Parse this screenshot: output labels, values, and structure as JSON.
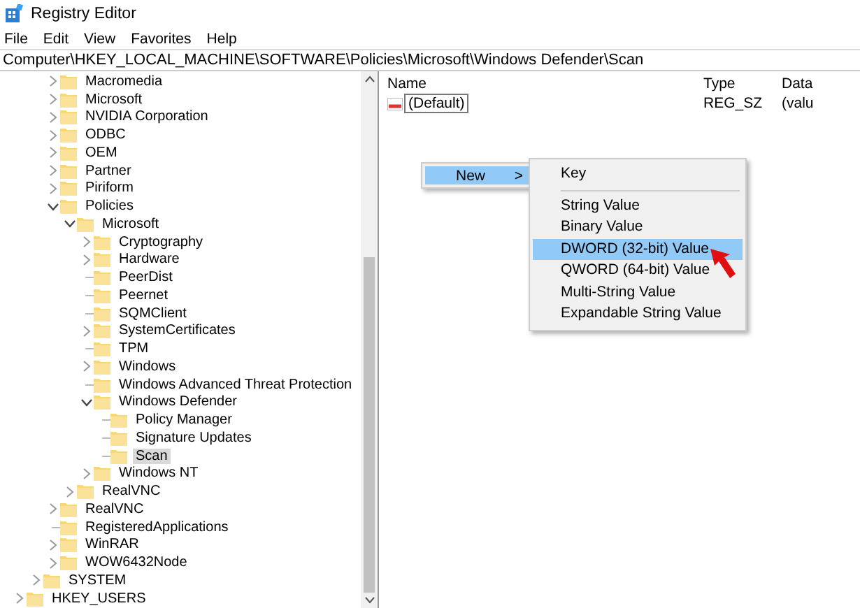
{
  "window": {
    "title": "Registry Editor"
  },
  "menu_bar": [
    "File",
    "Edit",
    "View",
    "Favorites",
    "Help"
  ],
  "address_bar": {
    "value": "Computer\\HKEY_LOCAL_MACHINE\\SOFTWARE\\Policies\\Microsoft\\Windows Defender\\Scan"
  },
  "tree": {
    "software_keys": [
      {
        "label": "Macromedia",
        "expanded": false,
        "selected": false
      },
      {
        "label": "Microsoft",
        "expanded": false,
        "selected": false
      },
      {
        "label": "NVIDIA Corporation",
        "expanded": false,
        "selected": false
      },
      {
        "label": "ODBC",
        "expanded": false,
        "selected": false
      },
      {
        "label": "OEM",
        "expanded": false,
        "selected": false
      },
      {
        "label": "Partner",
        "expanded": false,
        "selected": false
      },
      {
        "label": "Piriform",
        "expanded": false,
        "selected": false
      },
      {
        "label": "Policies",
        "expanded": true,
        "selected": false,
        "children": [
          {
            "label": "Microsoft",
            "expanded": true,
            "selected": false,
            "children": [
              {
                "label": "Cryptography",
                "expanded": false,
                "selected": false
              },
              {
                "label": "Hardware",
                "expanded": false,
                "selected": false
              },
              {
                "label": "PeerDist",
                "selected": false
              },
              {
                "label": "Peernet",
                "selected": false
              },
              {
                "label": "SQMClient",
                "selected": false
              },
              {
                "label": "SystemCertificates",
                "expanded": false,
                "selected": false
              },
              {
                "label": "TPM",
                "selected": false
              },
              {
                "label": "Windows",
                "expanded": false,
                "selected": false
              },
              {
                "label": "Windows Advanced Threat Protection",
                "selected": false
              },
              {
                "label": "Windows Defender",
                "expanded": true,
                "selected": false,
                "children": [
                  {
                    "label": "Policy Manager",
                    "selected": false
                  },
                  {
                    "label": "Signature Updates",
                    "selected": false
                  },
                  {
                    "label": "Scan",
                    "selected": true
                  }
                ]
              },
              {
                "label": "Windows NT",
                "expanded": false,
                "selected": false
              }
            ]
          },
          {
            "label": "RealVNC",
            "expanded": false,
            "selected": false
          }
        ]
      },
      {
        "label": "RealVNC",
        "expanded": false,
        "selected": false
      },
      {
        "label": "RegisteredApplications",
        "selected": false
      },
      {
        "label": "WinRAR",
        "expanded": false,
        "selected": false
      },
      {
        "label": "WOW6432Node",
        "expanded": false,
        "selected": false
      }
    ],
    "hklm_keys": [
      {
        "label": "SYSTEM",
        "expanded": false,
        "selected": false
      }
    ],
    "root_keys": [
      {
        "label": "HKEY_USERS",
        "expanded": false,
        "selected": false
      }
    ]
  },
  "values_table": {
    "columns": [
      "Name",
      "Type",
      "Data"
    ],
    "rows": [
      {
        "name": "(Default)",
        "type": "REG_SZ",
        "data": "(valu",
        "editing": true
      }
    ]
  },
  "context_menu": {
    "items": [
      {
        "label": "New",
        "arrow": ">",
        "selected": true
      }
    ]
  },
  "submenu": {
    "items": [
      {
        "label": "Key",
        "kind": "item",
        "selected": false
      },
      {
        "kind": "separator"
      },
      {
        "label": "String Value",
        "kind": "item",
        "selected": false
      },
      {
        "label": "Binary Value",
        "kind": "item",
        "selected": false
      },
      {
        "label": "DWORD (32-bit) Value",
        "kind": "item",
        "selected": true
      },
      {
        "label": "QWORD (64-bit) Value",
        "kind": "item",
        "selected": false
      },
      {
        "label": "Multi-String Value",
        "kind": "item",
        "selected": false
      },
      {
        "label": "Expandable String Value",
        "kind": "item",
        "selected": false
      }
    ]
  }
}
